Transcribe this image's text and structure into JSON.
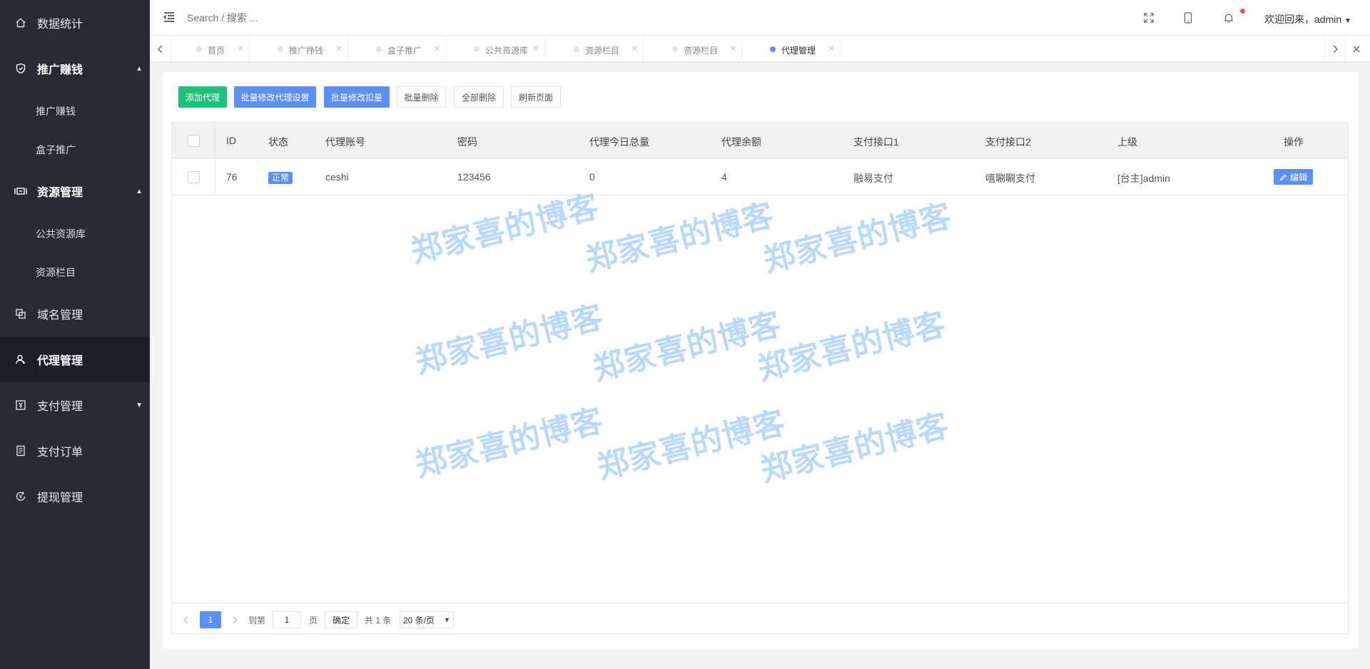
{
  "sidebar": {
    "items": [
      {
        "label": "数据统计",
        "icon": "home-icon"
      },
      {
        "label": "推广赚钱",
        "icon": "shield-icon",
        "expanded": true,
        "children": [
          "推广赚钱",
          "盒子推广"
        ]
      },
      {
        "label": "资源管理",
        "icon": "resource-icon",
        "expanded": true,
        "children": [
          "公共资源库",
          "资源栏目"
        ]
      },
      {
        "label": "域名管理",
        "icon": "domain-icon"
      },
      {
        "label": "代理管理",
        "icon": "user-icon",
        "active": true
      },
      {
        "label": "支付管理",
        "icon": "payment-icon",
        "collapsed": true
      },
      {
        "label": "支付订单",
        "icon": "order-icon"
      },
      {
        "label": "提现管理",
        "icon": "withdraw-icon"
      }
    ]
  },
  "header": {
    "search_placeholder": "Search / 搜索 ...",
    "welcome": "欢迎回来，admin",
    "notification_dot_color": "#ff4d4f"
  },
  "tabs": [
    {
      "label": "首页"
    },
    {
      "label": "推广挣钱"
    },
    {
      "label": "盒子推广"
    },
    {
      "label": "公共资源库"
    },
    {
      "label": "资源栏目"
    },
    {
      "label": "资源栏目"
    },
    {
      "label": "代理管理",
      "active": true
    }
  ],
  "toolbar": {
    "add": "添加代理",
    "batch_settings": "批量修改代理设置",
    "batch_deduct": "批量修改扣量",
    "batch_delete": "批量删除",
    "delete_all": "全部删除",
    "refresh": "刷新页面"
  },
  "table": {
    "columns": [
      "ID",
      "状态",
      "代理账号",
      "密码",
      "代理今日总量",
      "代理余额",
      "支付接口1",
      "支付接口2",
      "上级",
      "操作"
    ],
    "rows": [
      {
        "id": "76",
        "status": "正常",
        "account": "ceshi",
        "password": "123456",
        "today_total": "0",
        "balance": "4",
        "pay1": "融易支付",
        "pay2": "嘻唰唰支付",
        "parent": "[台主]admin",
        "action": "编辑"
      }
    ]
  },
  "pagination": {
    "current_page": "1",
    "goto_label": "到第",
    "goto_value": "1",
    "page_suffix": "页",
    "confirm": "确定",
    "total": "共 1 条",
    "page_size": "20 条/页"
  },
  "watermark": {
    "text": "郑家喜的博客"
  },
  "colors": {
    "sidebar_bg": "#282b33",
    "primary_blue": "#5b8ff9",
    "add_green": "#1ec27a"
  }
}
